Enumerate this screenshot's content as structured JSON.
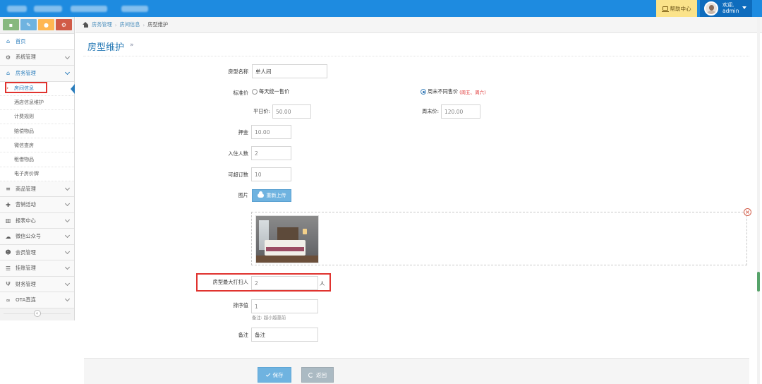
{
  "topbar": {
    "help_label": "帮助中心",
    "user": {
      "welcome": "欢迎,",
      "name": "admin"
    }
  },
  "sidebar": {
    "shortcuts": [
      "chart-icon",
      "pencil-icon",
      "users-icon",
      "cogs-icon"
    ],
    "items": [
      {
        "label": "首页",
        "icon": "home-icon"
      },
      {
        "label": "系统管理",
        "icon": "gear-icon"
      },
      {
        "label": "房务管理",
        "icon": "bank-icon"
      },
      {
        "label": "商品管理",
        "icon": "database-icon"
      },
      {
        "label": "营销活动",
        "icon": "gift-icon"
      },
      {
        "label": "报表中心",
        "icon": "bar-chart-icon"
      },
      {
        "label": "微信公众号",
        "icon": "cloud-icon"
      },
      {
        "label": "会员管理",
        "icon": "group-icon"
      },
      {
        "label": "挂账管理",
        "icon": "list-icon"
      },
      {
        "label": "财务管理",
        "icon": "cutlery-icon"
      },
      {
        "label": "OTA直连",
        "icon": "handshake-icon"
      }
    ],
    "subitems": [
      "房间信息",
      "酒店信息维护",
      "计费规则",
      "赔偿物品",
      "微信查房",
      "租借物品",
      "电子房价牌"
    ]
  },
  "breadcrumb": {
    "items": [
      "房务管理",
      "房间信息",
      "房型维护"
    ]
  },
  "page": {
    "title": "房型维护",
    "title_arrow": "»"
  },
  "form": {
    "room_name": {
      "label": "房型名称",
      "value": "单人间"
    },
    "standard_price": {
      "label": "标准价",
      "option_unified": "每天统一售价",
      "option_weekend": "周末不同售价",
      "weekend_note": "(周五、周六)",
      "selected": "option_weekend"
    },
    "weekday_price": {
      "label": "平日价:",
      "value": "50.00"
    },
    "weekend_price": {
      "label": "周末价:",
      "value": "120.00"
    },
    "deposit": {
      "label": "押金",
      "value": "10.00"
    },
    "occupancy": {
      "label": "入住人数",
      "value": "2"
    },
    "bookable": {
      "label": "可超订数",
      "value": "10"
    },
    "image": {
      "label": "图片",
      "upload_label": "重新上传"
    },
    "max_cleaners": {
      "label": "房型最大打扫人",
      "value": "2",
      "unit": "人"
    },
    "sort": {
      "label": "排序值",
      "value": "1",
      "hint": "备注: 越小越靠前"
    },
    "remark": {
      "label": "备注",
      "placeholder": "备注"
    },
    "save_label": "保存",
    "back_label": "返回"
  }
}
